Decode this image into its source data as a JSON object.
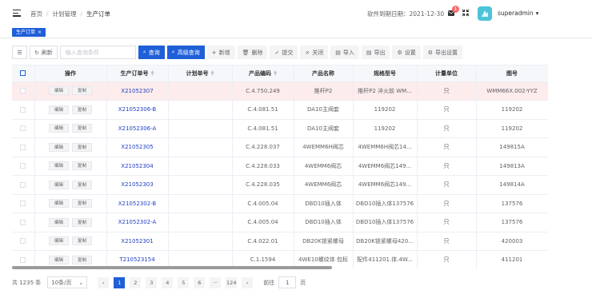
{
  "header": {
    "breadcrumb": [
      "首页",
      "计划管理",
      "生产订单"
    ],
    "expire_text": "软件到期日期：2021-12-30",
    "notification_count": "1",
    "username": "superadmin"
  },
  "tags": {
    "active": "生产订单"
  },
  "toolbar": {
    "refresh": "刷新",
    "search_placeholder": "输入查询条件",
    "query": "查询",
    "advanced_query": "高级查询",
    "add": "新增",
    "delete": "删除",
    "submit": "提交",
    "close": "关闭",
    "import": "导入",
    "export": "导出",
    "settings": "设置",
    "export_settings": "导出设置"
  },
  "table": {
    "columns": [
      "操作",
      "生产订单号",
      "计划单号",
      "产品编码",
      "产品名称",
      "规格型号",
      "计量单位",
      "图号"
    ],
    "row_actions": {
      "edit": "编辑",
      "copy": "复制"
    },
    "rows": [
      {
        "order": "X21052307",
        "plan": "",
        "code": "C.4.750.249",
        "name": "推杆P2",
        "spec": "推杆P2 淬火前 WM...",
        "unit": "只",
        "drawing": "WMM66X.002-YYZ"
      },
      {
        "order": "X21052306-B",
        "plan": "",
        "code": "C.4.081.51",
        "name": "DA10主阀套",
        "spec": "119202",
        "unit": "只",
        "drawing": "119202"
      },
      {
        "order": "X21052306-A",
        "plan": "",
        "code": "C.4.081.51",
        "name": "DA10主阀套",
        "spec": "119202",
        "unit": "只",
        "drawing": "119202"
      },
      {
        "order": "X21052305",
        "plan": "",
        "code": "C.4.228.037",
        "name": "4WEMM6H阀芯",
        "spec": "4WEMM6H阀芯14...",
        "unit": "只",
        "drawing": "149815A"
      },
      {
        "order": "X21052304",
        "plan": "",
        "code": "C.4.228.033",
        "name": "4WEMM6阀芯",
        "spec": "4WEMM6阀芯149...",
        "unit": "只",
        "drawing": "149813A"
      },
      {
        "order": "X21052303",
        "plan": "",
        "code": "C.4.228.035",
        "name": "4WEMM6阀芯",
        "spec": "4WEMM6阀芯149...",
        "unit": "只",
        "drawing": "149814A"
      },
      {
        "order": "X21052302-B",
        "plan": "",
        "code": "C.4.005.04",
        "name": "DBD10插入体",
        "spec": "DBD10插入体137576",
        "unit": "只",
        "drawing": "137576"
      },
      {
        "order": "X21052302-A",
        "plan": "",
        "code": "C.4.005.04",
        "name": "DBD10插入体",
        "spec": "DBD10插入体137576",
        "unit": "只",
        "drawing": "137576"
      },
      {
        "order": "X21052301",
        "plan": "",
        "code": "C.4.022.01",
        "name": "DB20K锁紧螺母",
        "spec": "DB20K锁紧螺母420...",
        "unit": "只",
        "drawing": "420003"
      },
      {
        "order": "T210523154",
        "plan": "",
        "code": "C.1.1594",
        "name": "4WE10螺纹体 包标",
        "spec": "配件411201.体.4W...",
        "unit": "只",
        "drawing": "411201"
      }
    ]
  },
  "pagination": {
    "total": "共 1235 条",
    "page_size": "10条/页",
    "pages": [
      "1",
      "2",
      "3",
      "4",
      "5",
      "6",
      "···",
      "124"
    ],
    "current": "1",
    "goto_label": "前往",
    "goto_value": "1",
    "goto_suffix": "页"
  }
}
